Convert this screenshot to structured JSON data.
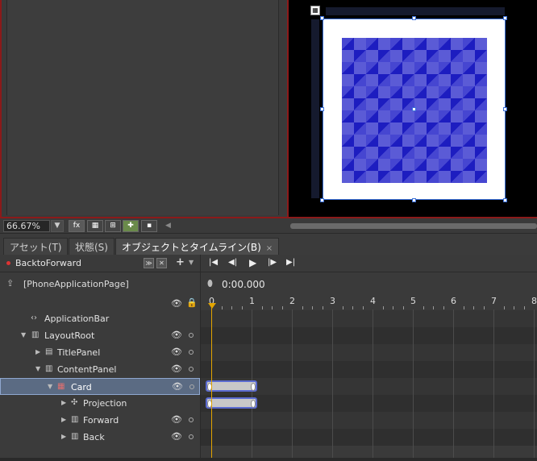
{
  "zoom": {
    "value": "66.67%"
  },
  "tabs": [
    {
      "label": "アセット(T)"
    },
    {
      "label": "状態(S)"
    },
    {
      "label": "オブジェクトとタイムライン(B)",
      "close": "×"
    }
  ],
  "storyboard": {
    "name": "BacktoForward"
  },
  "tree": {
    "root_label": "[PhoneApplicationPage]",
    "items": [
      {
        "label": "ApplicationBar"
      },
      {
        "label": "LayoutRoot"
      },
      {
        "label": "TitlePanel"
      },
      {
        "label": "ContentPanel"
      },
      {
        "label": "Card"
      },
      {
        "label": "Projection"
      },
      {
        "label": "Forward"
      },
      {
        "label": "Back"
      }
    ]
  },
  "timeline": {
    "current_time": "0:00.000",
    "ruler_labels": [
      "0",
      "1",
      "2",
      "3",
      "4",
      "5",
      "6",
      "7",
      "8"
    ],
    "keyframe_bars": [
      {
        "row": "Card",
        "start": 0,
        "end": 1
      },
      {
        "row": "Projection",
        "start": 0,
        "end": 1
      }
    ]
  },
  "colors": {
    "selection": "#5b6b83",
    "playhead": "#e2a400",
    "pattern_dark": "#1d1dc0",
    "pattern_light": "#5b5bd6"
  }
}
